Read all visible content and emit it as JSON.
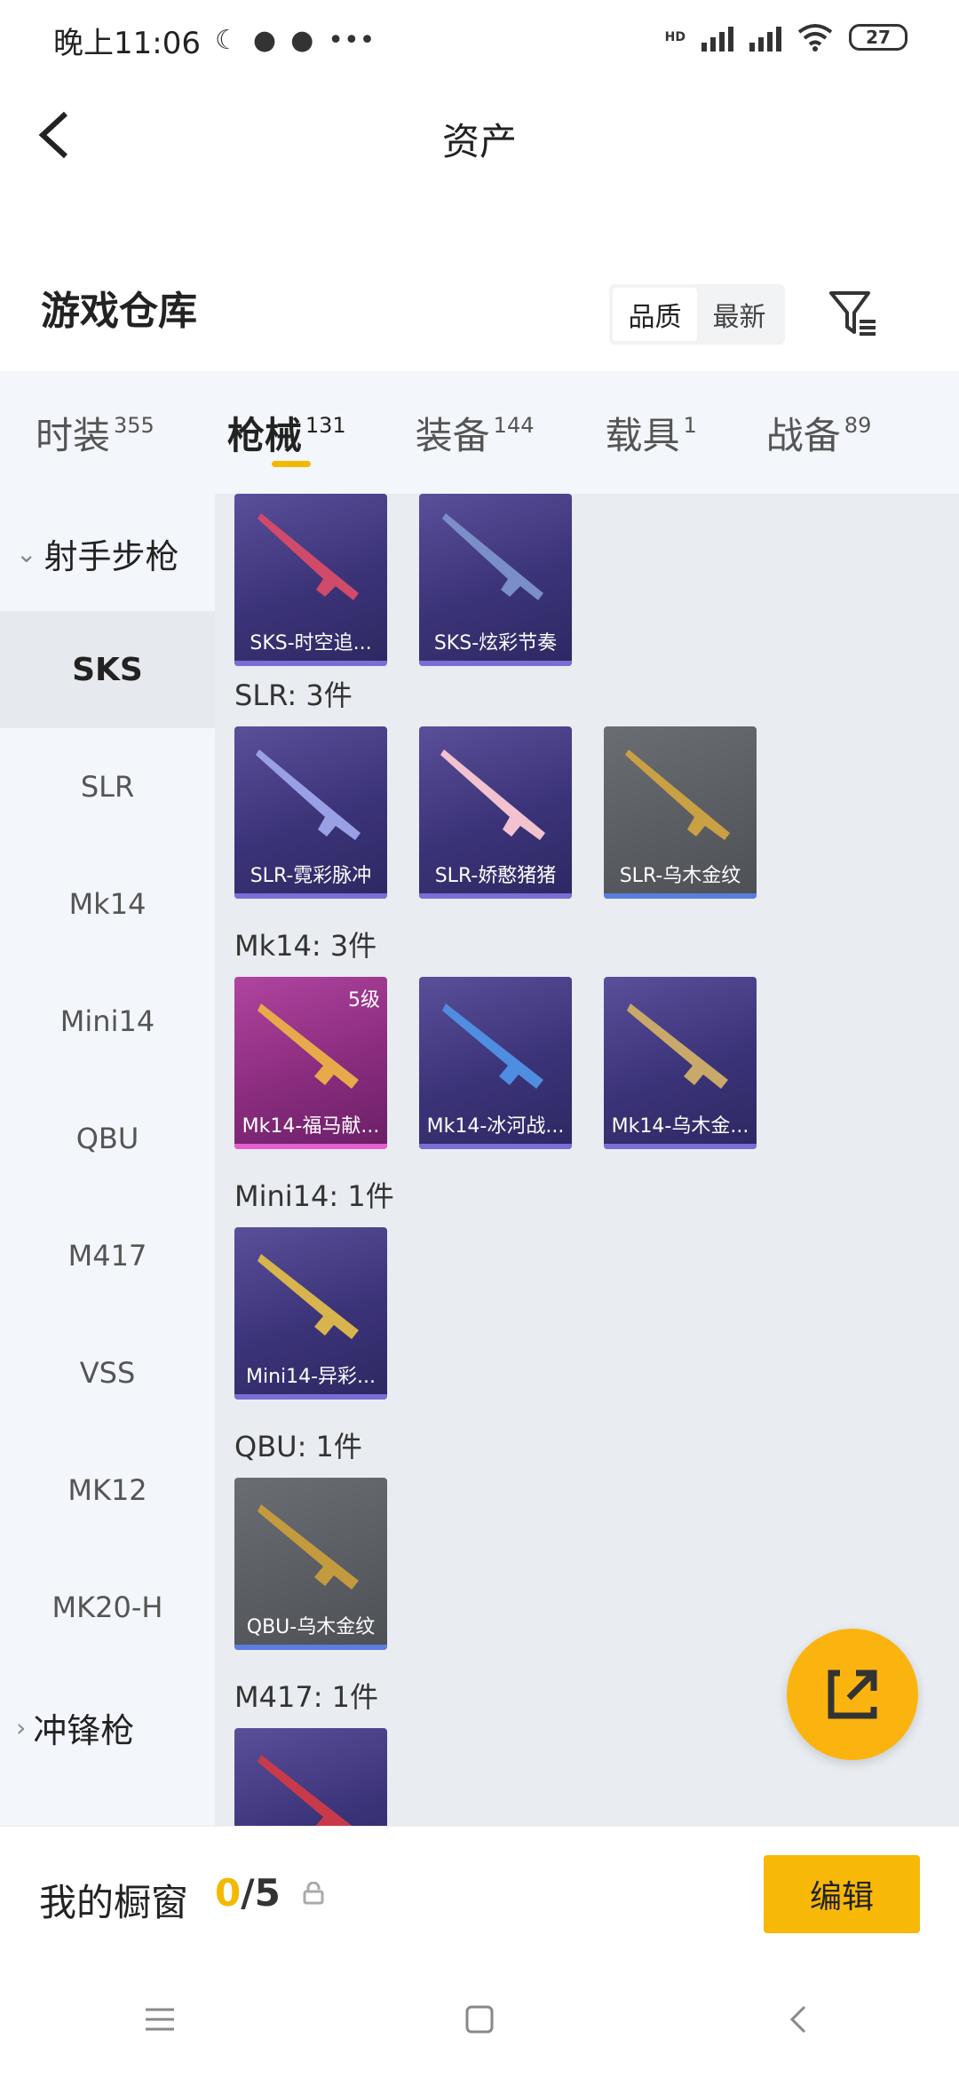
{
  "status_bar": {
    "time": "晚上11:06",
    "battery": "27",
    "network_label": "HD"
  },
  "header": {
    "title": "资产"
  },
  "section": {
    "title": "游戏仓库",
    "sort_options": [
      "品质",
      "最新"
    ]
  },
  "tabs": [
    {
      "label": "时装",
      "count": "355"
    },
    {
      "label": "枪械",
      "count": "131"
    },
    {
      "label": "装备",
      "count": "144"
    },
    {
      "label": "载具",
      "count": "1"
    },
    {
      "label": "战备",
      "count": "89"
    }
  ],
  "sidebar": {
    "group_open": "射手步枪",
    "items": [
      "SKS",
      "SLR",
      "Mk14",
      "Mini14",
      "QBU",
      "M417",
      "VSS",
      "MK12",
      "MK20-H"
    ],
    "group_closed": "冲锋枪"
  },
  "content": {
    "top_cards": [
      {
        "label": "SKS-时空追..."
      },
      {
        "label": "SKS-炫彩节奏"
      }
    ],
    "slr_header": "SLR: 3件",
    "slr_cards": [
      {
        "label": "SLR-霓彩脉冲"
      },
      {
        "label": "SLR-娇憨猪猪"
      },
      {
        "label": "SLR-乌木金纹"
      }
    ],
    "mk14_header": "Mk14: 3件",
    "mk14_cards": [
      {
        "label": "Mk14-福马献...",
        "level": "5级"
      },
      {
        "label": "Mk14-冰河战..."
      },
      {
        "label": "Mk14-乌木金..."
      }
    ],
    "mini14_header": "Mini14: 1件",
    "mini14_cards": [
      {
        "label": "Mini14-异彩..."
      }
    ],
    "qbu_header": "QBU: 1件",
    "qbu_cards": [
      {
        "label": "QBU-乌木金纹"
      }
    ],
    "m417_header": "M417: 1件"
  },
  "showcase": {
    "label": "我的橱窗",
    "count_current": "0",
    "count_total": "/5",
    "edit_label": "编辑"
  },
  "colors": {
    "accent": "#f5b800",
    "card_purple": "#3b3378",
    "card_grey": "#4d5055",
    "card_pink": "#8a2c7e"
  }
}
